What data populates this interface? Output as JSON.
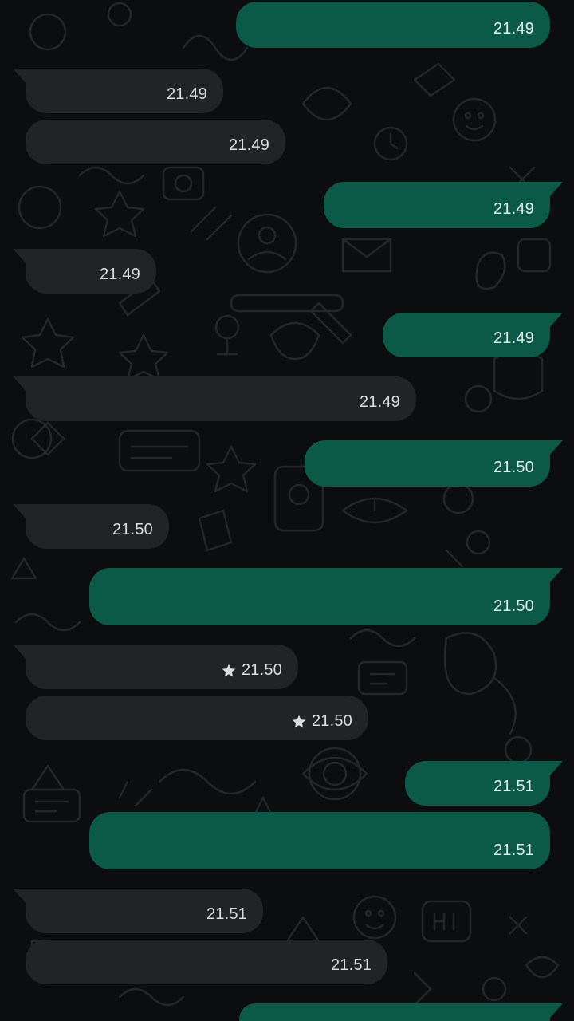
{
  "messages": [
    {
      "direction": "out",
      "time": "21.49",
      "starred": false
    },
    {
      "direction": "in",
      "time": "21.49",
      "starred": false
    },
    {
      "direction": "in",
      "time": "21.49",
      "starred": false
    },
    {
      "direction": "out",
      "time": "21.49",
      "starred": false
    },
    {
      "direction": "in",
      "time": "21.49",
      "starred": false
    },
    {
      "direction": "out",
      "time": "21.49",
      "starred": false
    },
    {
      "direction": "in",
      "time": "21.49",
      "starred": false
    },
    {
      "direction": "out",
      "time": "21.50",
      "starred": false
    },
    {
      "direction": "in",
      "time": "21.50",
      "starred": false
    },
    {
      "direction": "out",
      "time": "21.50",
      "starred": false
    },
    {
      "direction": "in",
      "time": "21.50",
      "starred": true
    },
    {
      "direction": "in",
      "time": "21.50",
      "starred": true
    },
    {
      "direction": "out",
      "time": "21.51",
      "starred": false
    },
    {
      "direction": "out",
      "time": "21.51",
      "starred": false
    },
    {
      "direction": "in",
      "time": "21.51",
      "starred": false
    },
    {
      "direction": "in",
      "time": "21.51",
      "starred": false
    },
    {
      "direction": "out",
      "time": "",
      "starred": false
    }
  ],
  "colors": {
    "background": "#0c0d0e",
    "incoming_bubble": "#202427",
    "outgoing_bubble": "#0b5a48",
    "timestamp": "#d9dedf"
  },
  "icons": {
    "star": "star-icon"
  }
}
